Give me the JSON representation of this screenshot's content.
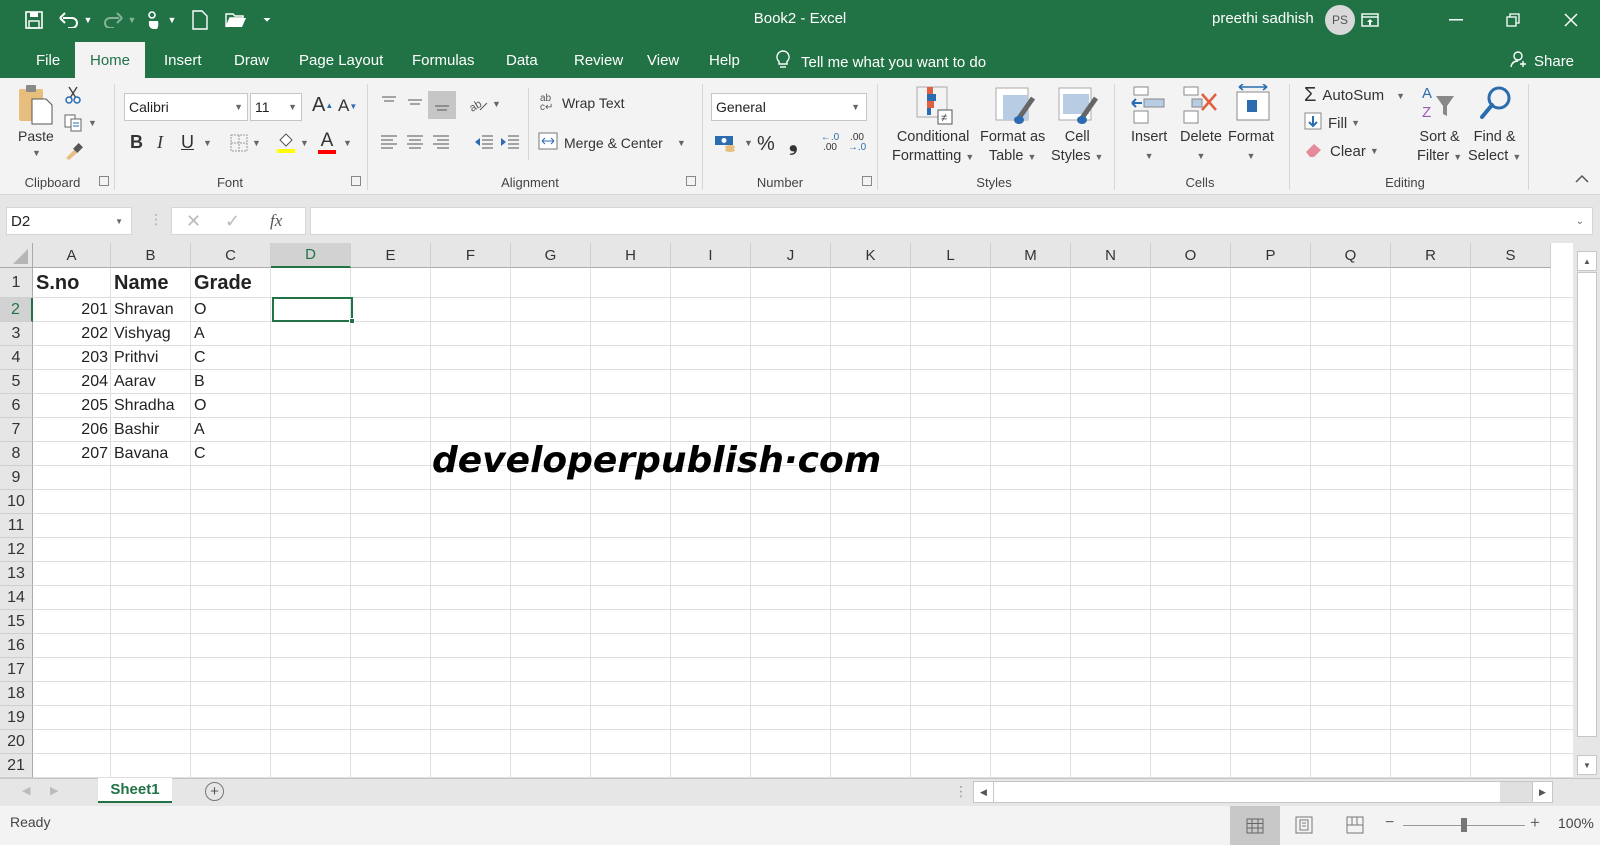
{
  "window": {
    "title": "Book2  -  Excel",
    "user_name": "preethi sadhish",
    "user_initials": "PS"
  },
  "quick_access": [
    {
      "icon": "save-icon",
      "glyph": "💾"
    },
    {
      "icon": "undo-icon",
      "glyph": "↶"
    },
    {
      "icon": "redo-icon",
      "glyph": "↷"
    },
    {
      "icon": "touch-mode-icon",
      "glyph": "☝"
    },
    {
      "icon": "new-file-icon",
      "glyph": "🗋"
    },
    {
      "icon": "open-folder-icon",
      "glyph": "📂"
    },
    {
      "icon": "customize-qat-icon",
      "glyph": "▾"
    }
  ],
  "tabs": [
    {
      "label": "File"
    },
    {
      "label": "Home"
    },
    {
      "label": "Insert"
    },
    {
      "label": "Draw"
    },
    {
      "label": "Page Layout"
    },
    {
      "label": "Formulas"
    },
    {
      "label": "Data"
    },
    {
      "label": "Review"
    },
    {
      "label": "View"
    },
    {
      "label": "Help"
    }
  ],
  "active_tab": "Home",
  "tell_me": "Tell me what you want to do",
  "share_label": "Share",
  "ribbon": {
    "clipboard": {
      "label": "Clipboard",
      "paste": "Paste"
    },
    "font": {
      "label": "Font",
      "font_name": "Calibri",
      "font_size": "11",
      "bold": "B",
      "italic": "I",
      "underline": "U",
      "fill_color": "#ffff00",
      "font_color": "#ff0000"
    },
    "alignment": {
      "label": "Alignment",
      "wrap_text": "Wrap Text",
      "merge_center": "Merge & Center"
    },
    "number": {
      "label": "Number",
      "format": "General",
      "percent": "%",
      "comma": "❟",
      "inc_decimal": "←.0 .00",
      "dec_decimal": ".00 →.0"
    },
    "styles": {
      "label": "Styles",
      "conditional_1": "Conditional",
      "conditional_2": "Formatting",
      "format_table_1": "Format as",
      "format_table_2": "Table",
      "cell_styles_1": "Cell",
      "cell_styles_2": "Styles"
    },
    "cells": {
      "label": "Cells",
      "insert": "Insert",
      "delete": "Delete",
      "format": "Format"
    },
    "editing": {
      "label": "Editing",
      "autosum": "AutoSum",
      "fill": "Fill",
      "clear": "Clear",
      "sort_1": "Sort &",
      "sort_2": "Filter",
      "find_1": "Find &",
      "find_2": "Select"
    }
  },
  "formula_bar": {
    "name_box": "D2",
    "formula": "",
    "fx": "fx"
  },
  "columns": [
    "A",
    "B",
    "C",
    "D",
    "E",
    "F",
    "G",
    "H",
    "I",
    "J",
    "K",
    "L",
    "M",
    "N",
    "O",
    "P",
    "Q",
    "R",
    "S"
  ],
  "rows": [
    "1",
    "2",
    "3",
    "4",
    "5",
    "6",
    "7",
    "8",
    "9",
    "10",
    "11",
    "12",
    "13",
    "14",
    "15",
    "16",
    "17",
    "18",
    "19",
    "20",
    "21"
  ],
  "selected_cell": "D2",
  "sheet": {
    "header": [
      "S.no",
      "Name",
      "Grade"
    ],
    "data": [
      [
        "201",
        "Shravan",
        "O"
      ],
      [
        "202",
        "Vishyag",
        "A"
      ],
      [
        "203",
        "Prithvi",
        "C"
      ],
      [
        "204",
        "Aarav",
        "B"
      ],
      [
        "205",
        "Shradha",
        "O"
      ],
      [
        "206",
        "Bashir",
        "A"
      ],
      [
        "207",
        "Bavana",
        "C"
      ]
    ]
  },
  "watermark": "developerpublish·com",
  "sheet_tabs": [
    {
      "label": "Sheet1",
      "active": true
    }
  ],
  "status": {
    "text": "Ready",
    "zoom": "100%",
    "zoom_fraction": 0.5
  },
  "colors": {
    "brand_green": "#217346"
  }
}
